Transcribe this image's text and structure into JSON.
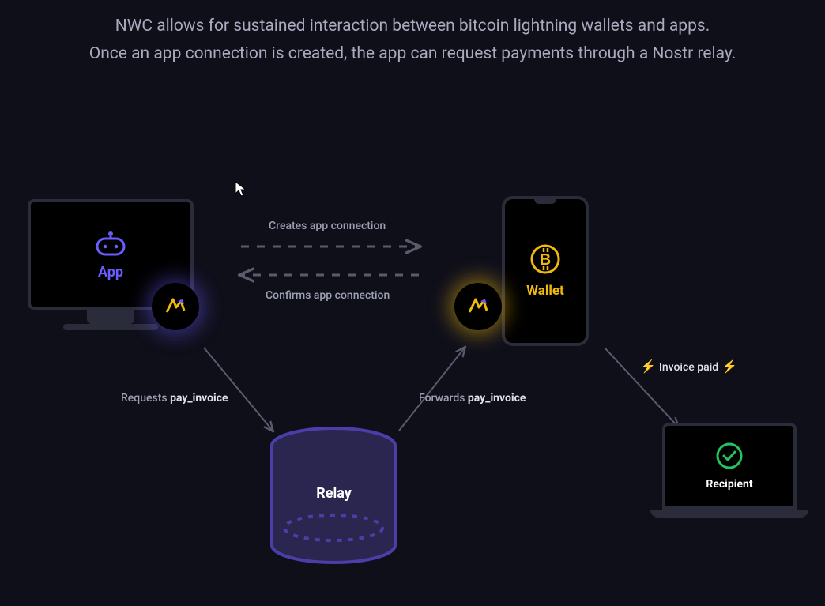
{
  "header": {
    "line1": "NWC allows for sustained interaction between bitcoin lightning wallets and apps.",
    "line2": "Once an app connection is created, the app can request payments through a Nostr relay."
  },
  "nodes": {
    "app": {
      "label": "App"
    },
    "wallet": {
      "label": "Wallet"
    },
    "relay": {
      "label": "Relay"
    },
    "recipient": {
      "label": "Recipient"
    }
  },
  "edges": {
    "creates_connection": "Creates app connection",
    "confirms_connection": "Confirms app connection",
    "requests_prefix": "Requests ",
    "requests_method": "pay_invoice",
    "forwards_prefix": "Forwards ",
    "forwards_method": "pay_invoice",
    "invoice_paid": "Invoice paid"
  },
  "icons": {
    "controller": "controller-icon",
    "bitcoin": "bitcoin-icon",
    "nwc_badge": "nwc-badge-icon",
    "check": "check-circle-icon",
    "lightning": "lightning-icon"
  }
}
